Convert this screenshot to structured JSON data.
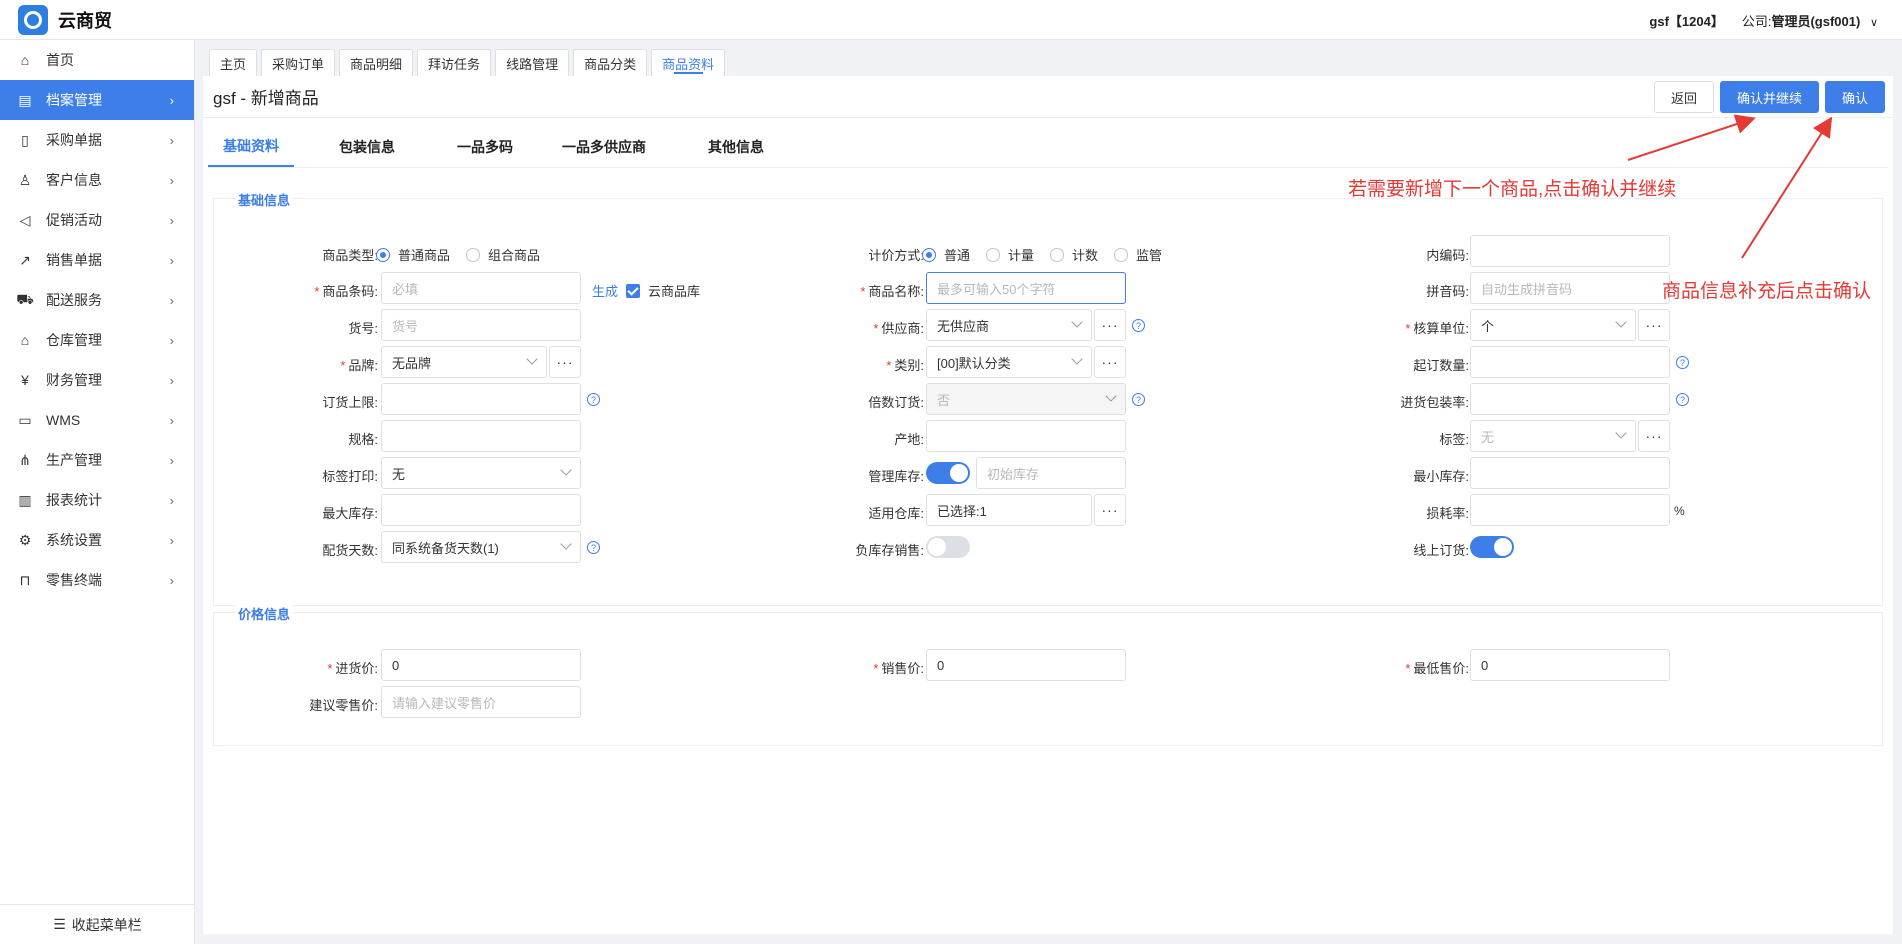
{
  "header": {
    "app_name": "云商贸",
    "user": "gsf【1204】",
    "company_label": "公司:",
    "company_value": "管理员(gsf001)"
  },
  "sidebar": {
    "items": [
      {
        "label": "首页",
        "icon": "home-icon"
      },
      {
        "label": "档案管理",
        "icon": "archive-icon"
      },
      {
        "label": "采购单据",
        "icon": "document-icon"
      },
      {
        "label": "客户信息",
        "icon": "user-icon"
      },
      {
        "label": "促销活动",
        "icon": "megaphone-icon"
      },
      {
        "label": "销售单据",
        "icon": "chart-line-icon"
      },
      {
        "label": "配送服务",
        "icon": "cart-icon"
      },
      {
        "label": "仓库管理",
        "icon": "warehouse-icon"
      },
      {
        "label": "财务管理",
        "icon": "finance-icon"
      },
      {
        "label": "WMS",
        "icon": "truck-icon"
      },
      {
        "label": "生产管理",
        "icon": "network-icon"
      },
      {
        "label": "报表统计",
        "icon": "bar-chart-icon"
      },
      {
        "label": "系统设置",
        "icon": "gear-icon"
      },
      {
        "label": "零售终端",
        "icon": "bag-icon"
      }
    ],
    "collapse_label": "收起菜单栏"
  },
  "tabs": [
    "主页",
    "采购订单",
    "商品明细",
    "拜访任务",
    "线路管理",
    "商品分类",
    "商品资料"
  ],
  "page": {
    "title": "gsf - 新增商品",
    "back_label": "返回",
    "confirm_continue_label": "确认并继续",
    "confirm_label": "确认"
  },
  "subtabs": [
    "基础资料",
    "包装信息",
    "一品多码",
    "一品多供应商",
    "其他信息"
  ],
  "basic": {
    "section_title": "基础信息",
    "product_type_label": "商品类型:",
    "product_type_options": [
      "普通商品",
      "组合商品"
    ],
    "pricing_label": "计价方式:",
    "pricing_options": [
      "普通",
      "计量",
      "计数",
      "监管"
    ],
    "internal_code_label": "内编码:",
    "barcode_label": "商品条码:",
    "barcode_placeholder": "必填",
    "generate_label": "生成",
    "cloud_lib_label": "云商品库",
    "name_label": "商品名称:",
    "name_placeholder": "最多可输入50个字符",
    "pinyin_label": "拼音码:",
    "pinyin_placeholder": "自动生成拼音码",
    "item_no_label": "货号:",
    "item_no_placeholder": "货号",
    "supplier_label": "供应商:",
    "supplier_value": "无供应商",
    "unit_label": "核算单位:",
    "unit_value": "个",
    "brand_label": "品牌:",
    "brand_value": "无品牌",
    "category_label": "类别:",
    "category_value": "[00]默认分类",
    "min_order_label": "起订数量:",
    "order_limit_label": "订货上限:",
    "multiple_order_label": "倍数订货:",
    "multiple_order_value": "否",
    "pack_rate_label": "进货包装率:",
    "spec_label": "规格:",
    "origin_label": "产地:",
    "tag_label": "标签:",
    "tag_value": "无",
    "tag_print_label": "标签打印:",
    "tag_print_value": "无",
    "manage_stock_label": "管理库存:",
    "initial_stock_placeholder": "初始库存",
    "min_stock_label": "最小库存:",
    "max_stock_label": "最大库存:",
    "warehouse_label": "适用仓库:",
    "warehouse_value": "已选择:1",
    "loss_rate_label": "损耗率:",
    "loss_rate_suffix": "%",
    "delivery_days_label": "配货天数:",
    "delivery_days_value": "同系统备货天数(1)",
    "negative_stock_label": "负库存销售:",
    "online_order_label": "线上订货:"
  },
  "price": {
    "section_title": "价格信息",
    "purchase_label": "进货价:",
    "purchase_value": "0",
    "sale_label": "销售价:",
    "sale_value": "0",
    "min_sale_label": "最低售价:",
    "min_sale_value": "0",
    "retail_label": "建议零售价:",
    "retail_placeholder": "请输入建议零售价"
  },
  "annotations": {
    "continue_hint": "若需要新增下一个商品,点击确认并继续",
    "confirm_hint": "商品信息补充后点击确认"
  },
  "colors": {
    "accent": "#3d7ee8",
    "annotation": "#e53935"
  }
}
